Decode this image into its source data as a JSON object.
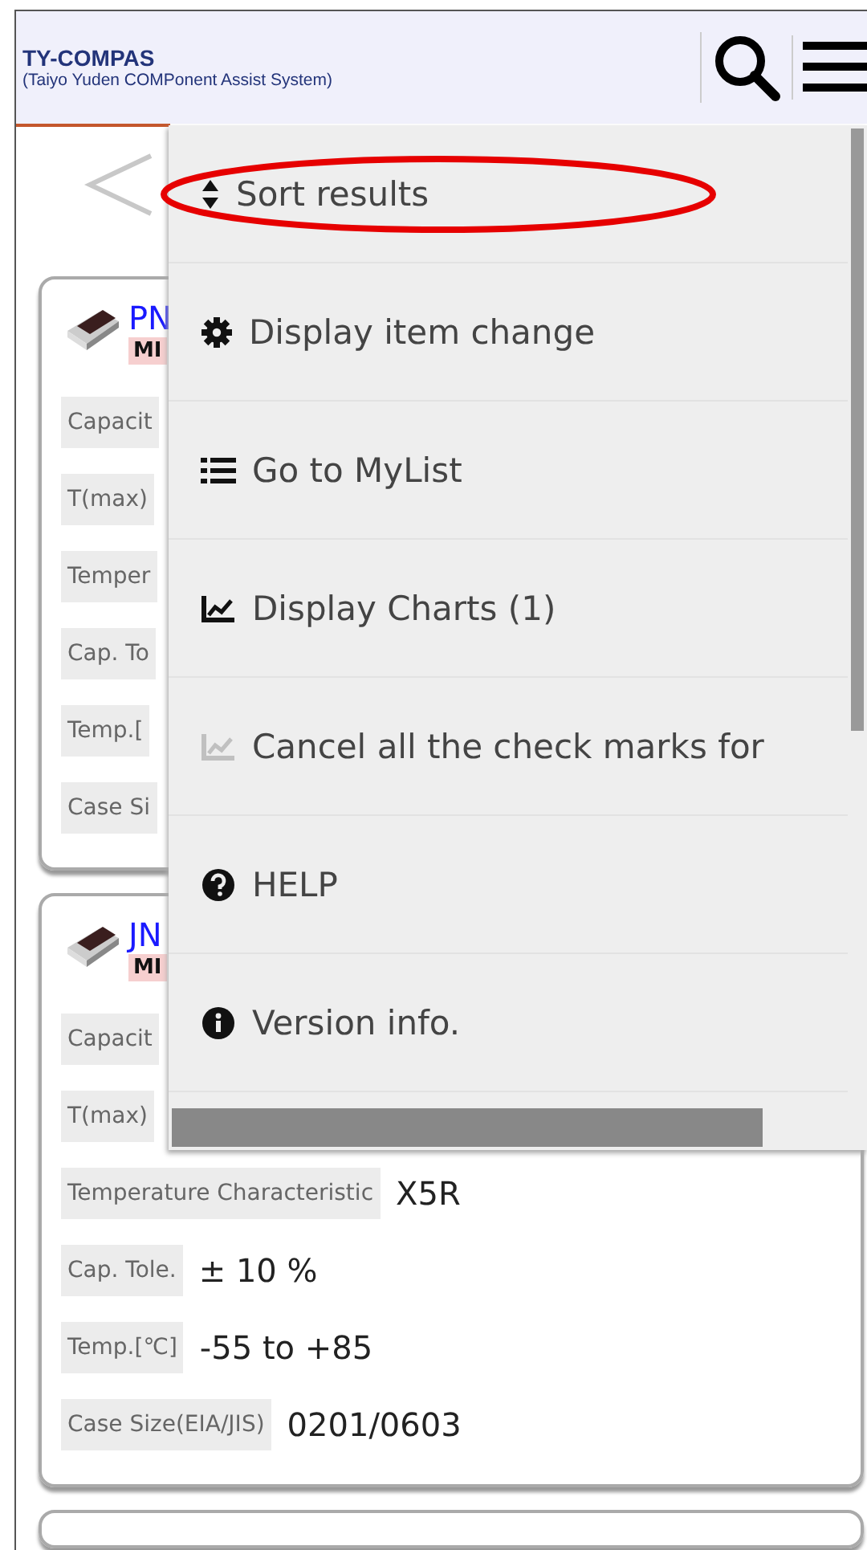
{
  "header": {
    "title": "TY-COMPAS",
    "subtitle": "(Taiyo Yuden COMPonent Assist System)"
  },
  "cards": [
    {
      "part_number": "PN",
      "badge": "MI",
      "rows": [
        {
          "label": "Capacit"
        },
        {
          "label": "T(max)"
        },
        {
          "label": "Temper"
        },
        {
          "label": "Cap. To"
        },
        {
          "label": "Temp.["
        },
        {
          "label": "Case Si"
        }
      ]
    },
    {
      "part_number": "JN",
      "badge": "MI",
      "rows": [
        {
          "label": "Capacit"
        },
        {
          "label": "T(max)"
        },
        {
          "label": "Temperature Characteristic",
          "value": "X5R"
        },
        {
          "label": "Cap. Tole.",
          "value": "± 10 %"
        },
        {
          "label": "Temp.[℃]",
          "value": "-55 to +85"
        },
        {
          "label": "Case Size(EIA/JIS)",
          "value": "0201/0603"
        }
      ]
    }
  ],
  "menu": {
    "items": [
      {
        "kind": "sort",
        "label": "Sort results",
        "disabled": false,
        "highlighted": true
      },
      {
        "kind": "gear",
        "label": "Display item change",
        "disabled": false,
        "highlighted": false
      },
      {
        "kind": "list",
        "label": "Go to MyList",
        "disabled": false,
        "highlighted": false
      },
      {
        "kind": "chart",
        "label": "Display Charts (1)",
        "disabled": false,
        "highlighted": false
      },
      {
        "kind": "chart",
        "label": "Cancel all the check marks for",
        "disabled": true,
        "highlighted": false
      },
      {
        "kind": "help",
        "label": "HELP",
        "disabled": false,
        "highlighted": false
      },
      {
        "kind": "info",
        "label": "Version info.",
        "disabled": false,
        "highlighted": false
      }
    ]
  }
}
